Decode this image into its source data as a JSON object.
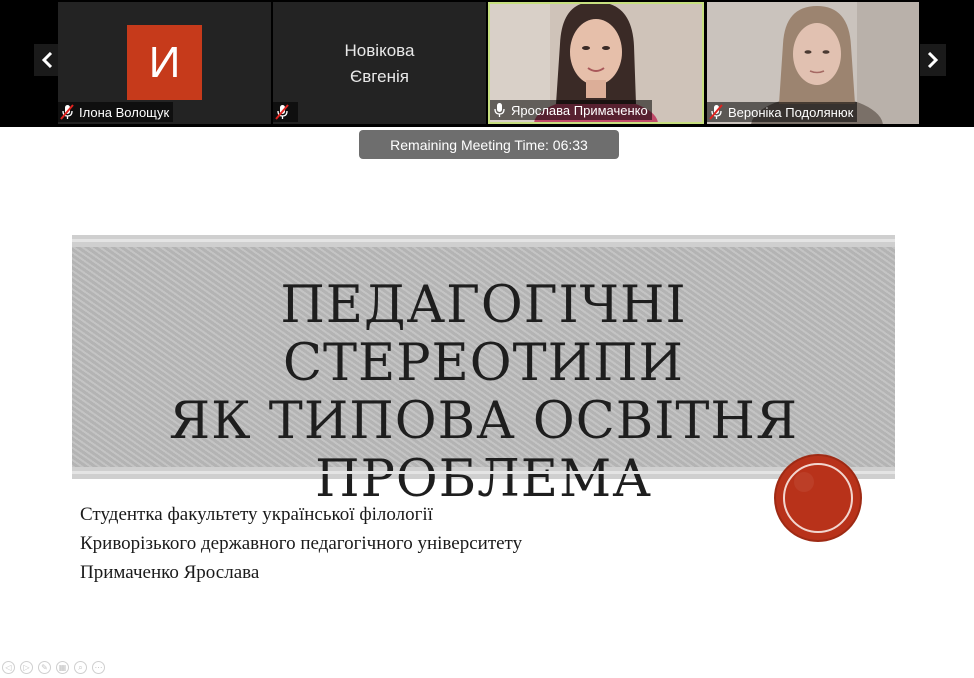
{
  "participants": [
    {
      "name": "Ілона Волощук",
      "initial": "И",
      "muted": true
    },
    {
      "name": "Новікова Євгенія",
      "name_line1": "Новікова",
      "name_line2": "Євгенія",
      "muted": true
    },
    {
      "name": "Ярослава Примаченко",
      "muted": false,
      "active_speaker": true
    },
    {
      "name": "Вероніка Подолянюк",
      "muted": true
    }
  ],
  "meeting": {
    "remaining_time": "Remaining Meeting Time: 06:33"
  },
  "slide": {
    "title_lines": [
      "ПЕДАГОГІЧНІ СТЕРЕОТИПИ",
      "ЯК ТИПОВА ОСВІТНЯ",
      "ПРОБЛЕМА"
    ],
    "subtitle_lines": [
      "Студентка факультету української філології",
      "Криворізького державного педагогічного університету",
      "Примаченко Ярослава"
    ]
  },
  "colors": {
    "avatar_bg": "#c63a1b",
    "active_speaker_border": "#c7df7f",
    "seal": "#b8321a",
    "timer_bg": "#6e6e6e"
  },
  "icons": {
    "muted": "mic-muted-icon",
    "unmuted": "mic-icon",
    "prev": "chevron-left-icon",
    "next": "chevron-right-icon"
  }
}
